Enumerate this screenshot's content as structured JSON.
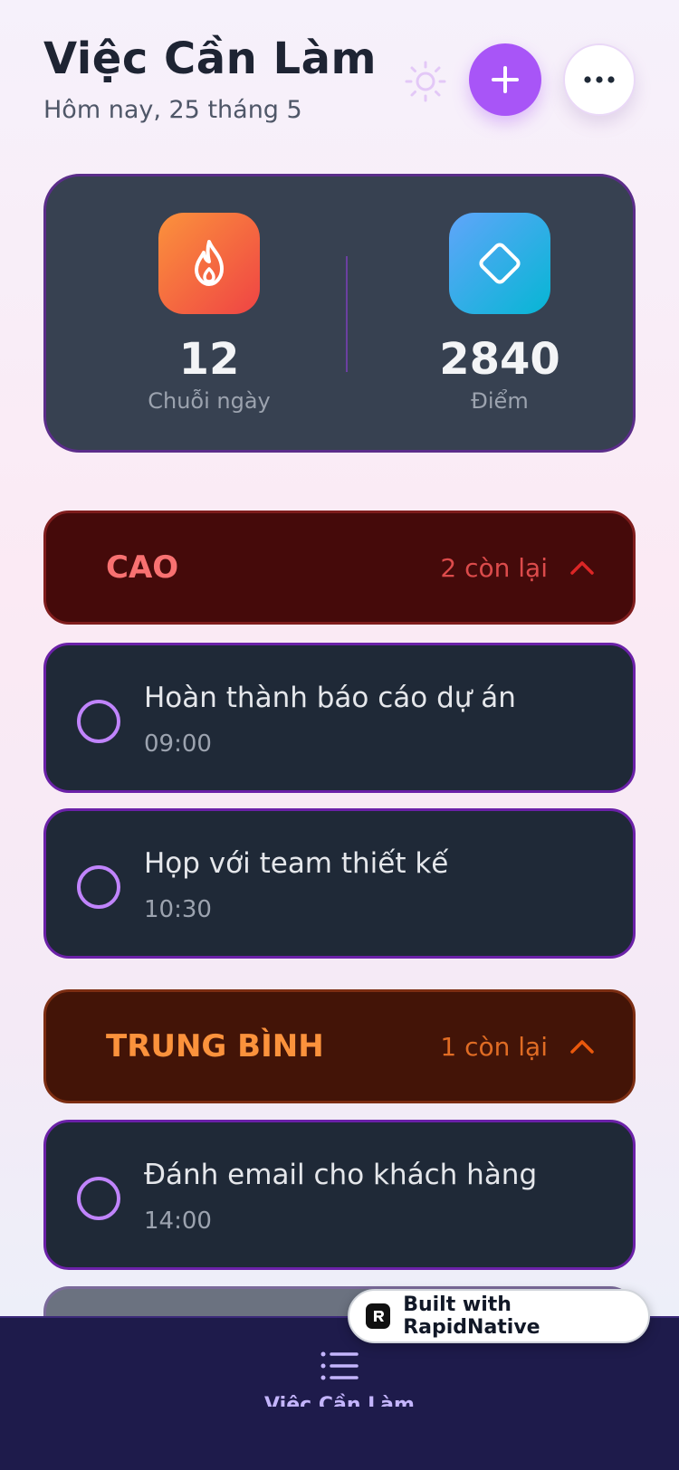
{
  "header": {
    "title": "Việc Cần Làm",
    "subtitle": "Hôm nay, 25 tháng 5",
    "theme_icon": "sun-icon",
    "add_icon": "plus-icon",
    "more_icon": "more-horizontal-icon"
  },
  "stats": {
    "streak": {
      "icon": "flame-icon",
      "value": "12",
      "label": "Chuỗi ngày"
    },
    "points": {
      "icon": "diamond-icon",
      "value": "2840",
      "label": "Điểm"
    }
  },
  "groups": [
    {
      "title": "CAO",
      "count": "2 còn lại",
      "accent": "#f87171",
      "tasks": [
        {
          "title": "Hoàn thành báo cáo dự án",
          "time": "09:00"
        },
        {
          "title": "Họp với team thiết kế",
          "time": "10:30"
        }
      ]
    },
    {
      "title": "TRUNG BÌNH",
      "count": "1 còn lại",
      "accent": "#fb923c",
      "tasks": [
        {
          "title": "Đánh email cho khách hàng",
          "time": "14:00"
        }
      ]
    }
  ],
  "bottom_nav": {
    "items": [
      {
        "label": "Việc Cần Làm",
        "icon": "list-icon",
        "active": true
      }
    ]
  },
  "badge": {
    "text": "Built with RapidNative"
  },
  "colors": {
    "accent": "#a855f7",
    "card_bg": "#1f2937",
    "nav_bg": "#1e1b4b"
  }
}
